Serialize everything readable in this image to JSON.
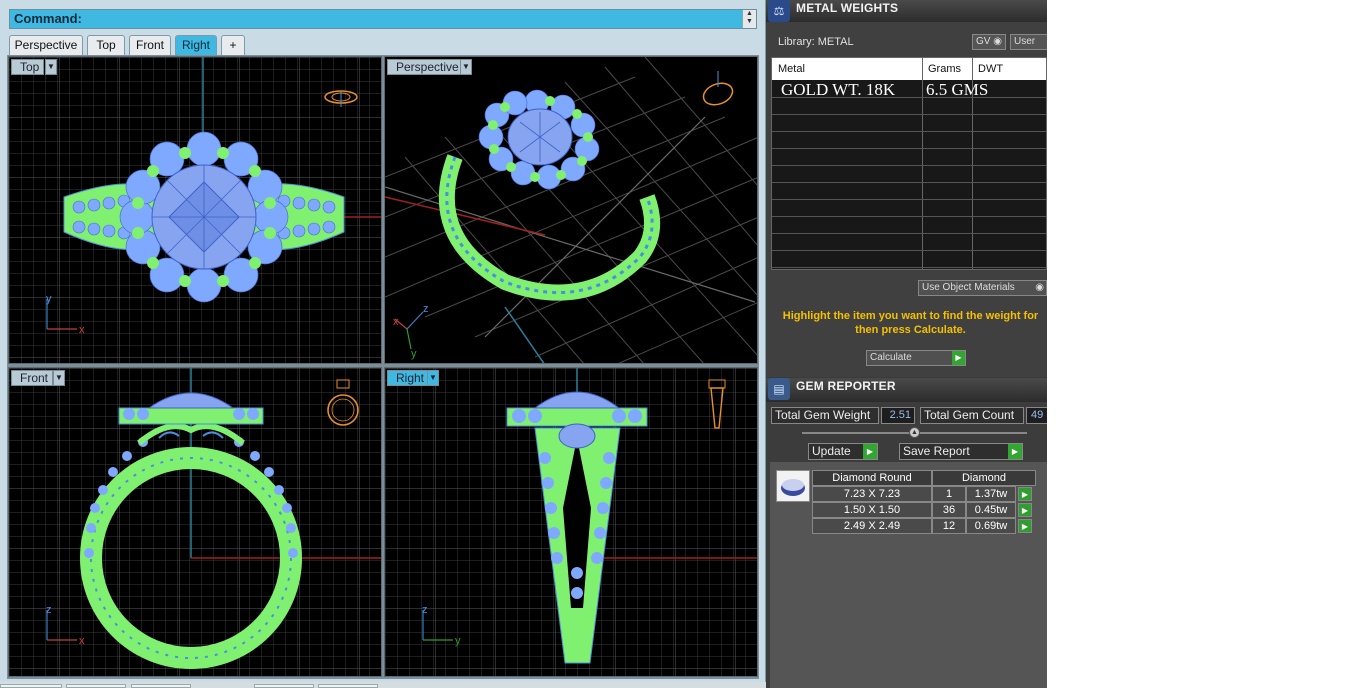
{
  "command": {
    "label": "Command:"
  },
  "tabs": [
    "Perspective",
    "Top",
    "Front",
    "Right",
    "+"
  ],
  "viewports": {
    "top": {
      "label": "Top"
    },
    "perspective": {
      "label": "Perspective"
    },
    "front": {
      "label": "Front"
    },
    "right": {
      "label": "Right"
    }
  },
  "axes": {
    "x": "x",
    "y": "y",
    "z": "z"
  },
  "metal_weights": {
    "title": "METAL WEIGHTS",
    "library_label": "Library: METAL",
    "gv_button": "GV",
    "user_button": "User",
    "columns": [
      "Metal",
      "Grams",
      "DWT"
    ],
    "rows": [
      {
        "metal": "GOLD WT. 18K",
        "grams": "6.5 GMS",
        "dwt": ""
      }
    ],
    "use_object_materials": "Use Object Materials",
    "hint": "Highlight the item you want to find the weight for then press Calculate.",
    "calculate_button": "Calculate"
  },
  "gem_reporter": {
    "title": "GEM REPORTER",
    "total_weight_label": "Total Gem Weight",
    "total_weight_value": "2.51",
    "total_count_label": "Total Gem Count",
    "total_count_value": "49",
    "update_button": "Update",
    "save_report_button": "Save Report",
    "table_header": [
      "Diamond Round",
      "Diamond"
    ],
    "rows": [
      {
        "size": "7.23 X 7.23",
        "count": "1",
        "weight": "1.37tw"
      },
      {
        "size": "1.50 X 1.50",
        "count": "36",
        "weight": "0.45tw"
      },
      {
        "size": "2.49 X 2.49",
        "count": "12",
        "weight": "0.69tw"
      }
    ]
  },
  "colors": {
    "accent": "#3fb8e2",
    "ring_metal": "#7cff6a",
    "gem_blue": "#7fa8ff",
    "hint_yellow": "#f5c000",
    "play_green": "#33a533"
  }
}
